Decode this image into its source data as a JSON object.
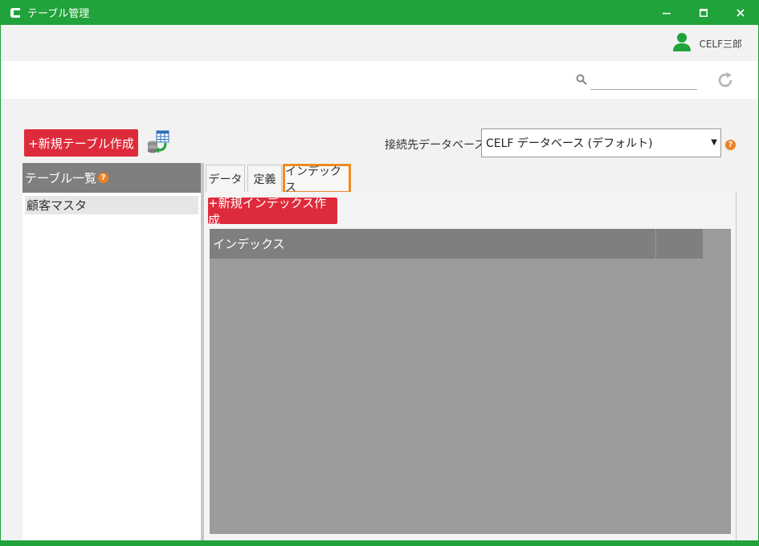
{
  "window": {
    "title": "テーブル管理",
    "controls": {
      "minimize": "‒",
      "maximize": "☐",
      "close": "✕"
    }
  },
  "user": {
    "name": "CELF三郎"
  },
  "search": {
    "value": "",
    "placeholder": ""
  },
  "toolbar": {
    "new_table_label": "+新規テーブル作成",
    "connection_label": "接続先データベース",
    "database_selected": "CELF データベース (デフォルト)"
  },
  "left_panel": {
    "header": "テーブル一覧",
    "items": [
      {
        "label": "顧客マスタ"
      }
    ]
  },
  "tabs": [
    {
      "label": "データ"
    },
    {
      "label": "定義"
    },
    {
      "label": "インデックス"
    }
  ],
  "index_panel": {
    "new_index_label": "+新規インデックス作成",
    "column_header": "インデックス"
  },
  "help_glyph": "?",
  "colors": {
    "titlebar": "#20a33a",
    "accent_red": "#de2b3b",
    "active_tab_border": "#f08a22",
    "header_gray": "#7f7f7f"
  },
  "icons": {
    "app": "celf-logo-icon",
    "user": "user-icon",
    "search": "search-icon",
    "refresh": "refresh-icon",
    "database": "database-table-icon",
    "help": "help-icon"
  }
}
